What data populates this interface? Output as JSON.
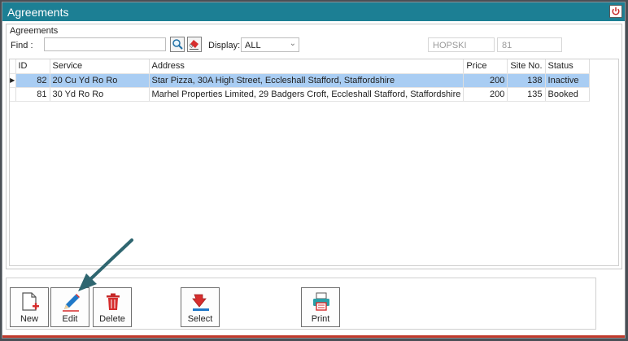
{
  "window": {
    "title": "Agreements"
  },
  "group": {
    "label": "Agreements"
  },
  "filters": {
    "find_label": "Find :",
    "find_value": "",
    "display_label": "Display:",
    "display_value": "ALL",
    "user_code": "HOPSKI",
    "count": "81"
  },
  "table": {
    "columns": [
      "ID",
      "Service",
      "Address",
      "Price",
      "Site No.",
      "Status"
    ],
    "rows": [
      {
        "id": "82",
        "service": "20 Cu Yd Ro Ro",
        "address": "Star Pizza, 30A High Street, Eccleshall Stafford, Staffordshire",
        "price": "200",
        "site_no": "138",
        "status": "Inactive"
      },
      {
        "id": "81",
        "service": "30 Yd Ro Ro",
        "address": "Marhel Properties Limited, 29 Badgers Croft, Eccleshall Stafford, Staffordshire",
        "price": "200",
        "site_no": "135",
        "status": "Booked"
      }
    ]
  },
  "toolbar": {
    "new": "New",
    "edit": "Edit",
    "delete": "Delete",
    "select": "Select",
    "print": "Print"
  },
  "icons": {
    "power": "power-icon",
    "search": "search-icon",
    "eraser": "eraser-icon",
    "new": "new-document-icon",
    "edit": "pencil-icon",
    "delete": "trash-icon",
    "select": "down-arrow-icon",
    "print": "printer-icon"
  },
  "colors": {
    "title_bar": "#1c7f94",
    "selected_row": "#a9cdf3",
    "accent_red": "#d62d2d",
    "annotation_arrow": "#2f6670"
  }
}
